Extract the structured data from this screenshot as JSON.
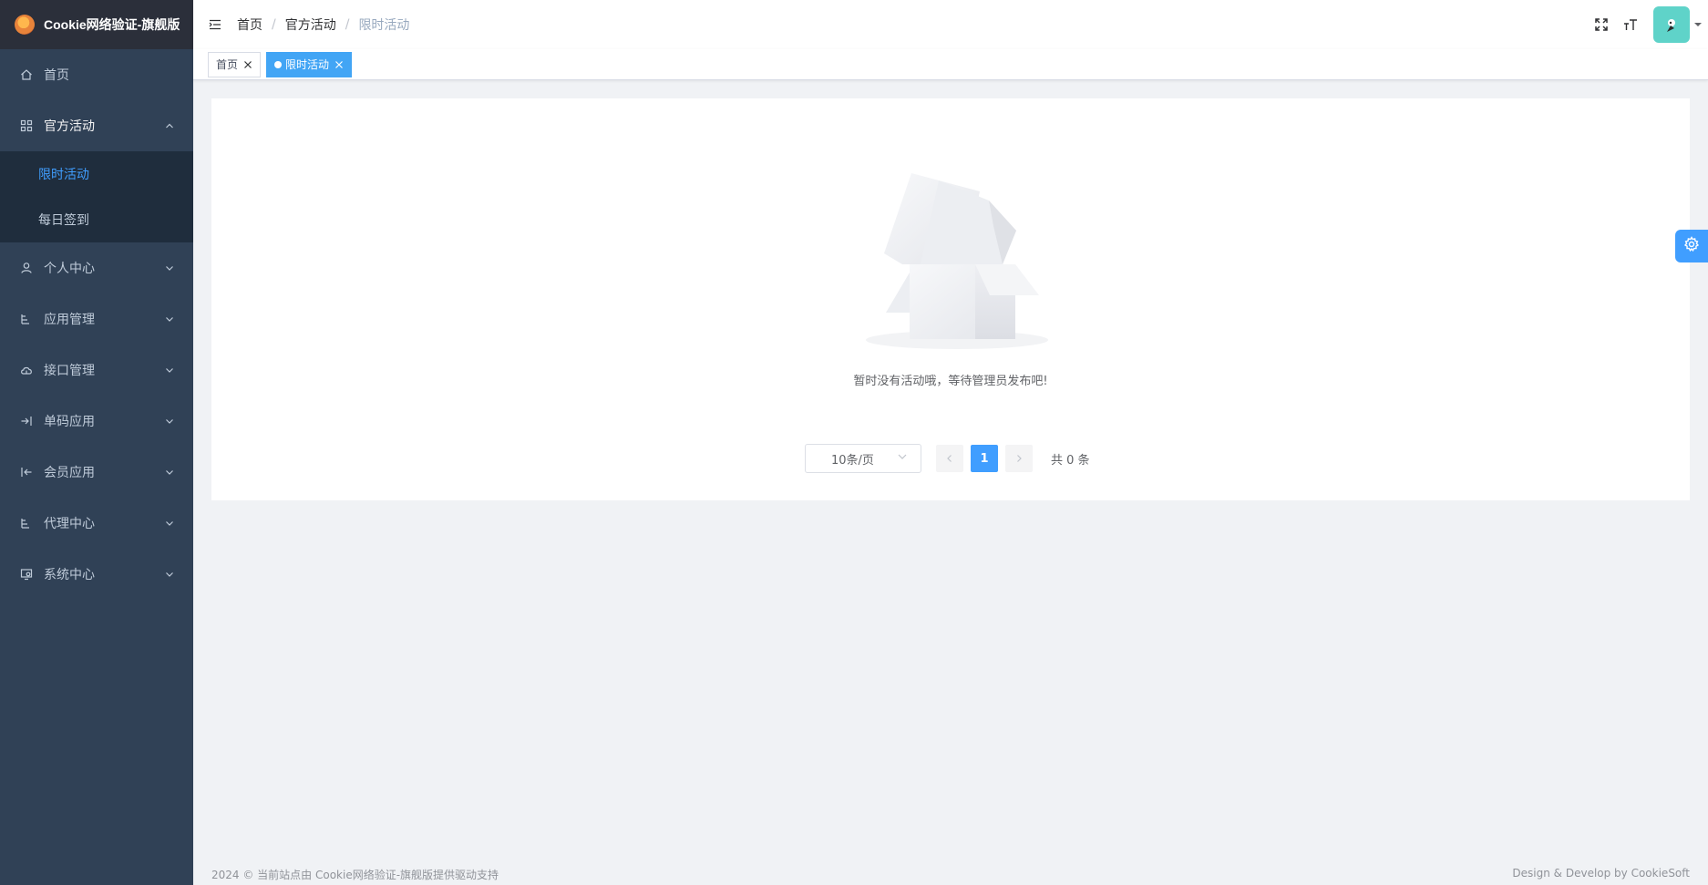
{
  "sidebar": {
    "logo_title": "Cookie网络验证-旗舰版",
    "menu": [
      {
        "label": "首页",
        "icon": "home-icon"
      },
      {
        "label": "官方活动",
        "icon": "grid-icon",
        "open": true,
        "children": [
          {
            "label": "限时活动",
            "active": true
          },
          {
            "label": "每日签到"
          }
        ]
      },
      {
        "label": "个人中心",
        "icon": "user-icon"
      },
      {
        "label": "应用管理",
        "icon": "tree-icon"
      },
      {
        "label": "接口管理",
        "icon": "cloud-icon"
      },
      {
        "label": "单码应用",
        "icon": "login-icon"
      },
      {
        "label": "会员应用",
        "icon": "logout-icon"
      },
      {
        "label": "代理中心",
        "icon": "tree-icon"
      },
      {
        "label": "系统中心",
        "icon": "monitor-icon"
      }
    ]
  },
  "navbar": {
    "breadcrumb": [
      "首页",
      "官方活动",
      "限时活动"
    ],
    "separator": "/"
  },
  "tags": [
    {
      "label": "首页",
      "active": false
    },
    {
      "label": "限时活动",
      "active": true
    }
  ],
  "main": {
    "empty_text": "暂时没有活动哦，等待管理员发布吧!",
    "pagination": {
      "page_size_label": "10条/页",
      "current_page": "1",
      "total_text": "共 0 条"
    }
  },
  "footer": {
    "left": "2024 © 当前站点由 Cookie网络验证-旗舰版提供驱动支持",
    "right": "Design & Develop by CookieSoft"
  },
  "colors": {
    "sidebar_bg": "#304156",
    "submenu_bg": "#1f2d3d",
    "accent": "#409eff",
    "tag_active": "#42a5f5"
  }
}
